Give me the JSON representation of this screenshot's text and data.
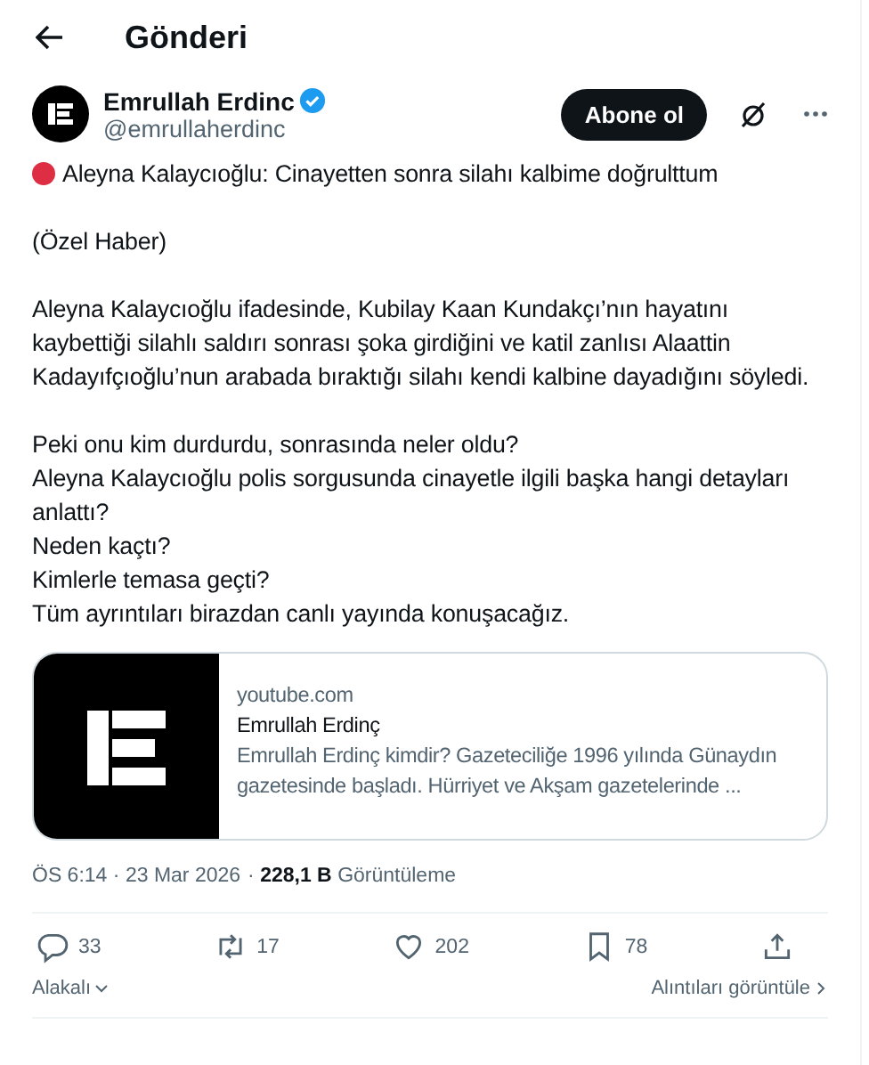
{
  "header": {
    "title": "Gönderi"
  },
  "author": {
    "name": "Emrullah Erdinc",
    "verified": true,
    "handle": "@emrullaherdinc"
  },
  "subscribe_button": "Abone ol",
  "post": {
    "paragraphs": [
      {
        "kind": "headline",
        "text": "Aleyna Kalaycıoğlu: Cinayetten sonra silahı kalbime doğrulttum"
      },
      {
        "kind": "plain",
        "text": "(Özel Haber)"
      },
      {
        "kind": "plain",
        "text": "Aleyna Kalaycıoğlu ifadesinde, Kubilay Kaan Kundakçı’nın hayatını kaybettiği silahlı saldırı sonrası şoka girdiğini ve katil zanlısı Alaattin Kadayıfçıoğlu’nun arabada bıraktığı silahı kendi kalbine dayadığını söyledi."
      },
      {
        "kind": "lines",
        "lines": [
          "Peki onu kim durdurdu, sonrasında neler oldu?",
          "Aleyna Kalaycıoğlu polis sorgusunda cinayetle ilgili başka hangi detayları anlattı?",
          "Neden kaçtı?",
          "Kimlerle temasa geçti?",
          "Tüm ayrıntıları birazdan canlı yayında konuşacağız."
        ]
      }
    ]
  },
  "link_card": {
    "domain": "youtube.com",
    "title": "Emrullah Erdinç",
    "description": "Emrullah Erdinç kimdir? Gazeteciliğe 1996 yılında Günaydın gazetesinde başladı. Hürriyet ve Akşam gazetelerinde ..."
  },
  "meta": {
    "time": "ÖS 6:14",
    "separator": "·",
    "date": "23 Mar 2026",
    "separator_2": "·",
    "views": "228,1 B",
    "views_label": "Görüntüleme"
  },
  "actions": [
    {
      "kind": "reply",
      "count": "33"
    },
    {
      "kind": "repost",
      "count": "17"
    },
    {
      "kind": "like",
      "count": "202"
    },
    {
      "kind": "bookmark",
      "count": "78"
    },
    {
      "kind": "share"
    }
  ],
  "footer": {
    "sort": "Alakalı",
    "quotes": "Alıntıları görüntüle"
  }
}
